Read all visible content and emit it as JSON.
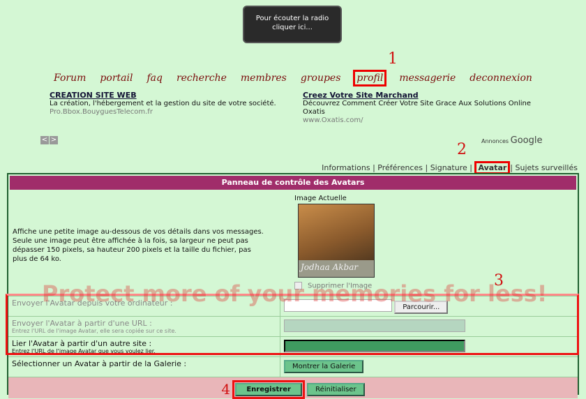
{
  "radio": {
    "text": "Pour écouter la radio cliquer ici..."
  },
  "nav": [
    "Forum",
    "portail",
    "faq",
    "recherche",
    "membres",
    "groupes",
    "profil",
    "messagerie",
    "deconnexion"
  ],
  "annotations": [
    "1",
    "2",
    "3",
    "4"
  ],
  "ads": [
    {
      "title": "CREATION SITE WEB",
      "text": "La création, l'hébergement et la gestion du site de votre société.",
      "url": "Pro.Bbox.BouyguesTelecom.fr"
    },
    {
      "title": "Creez Votre Site Marchand",
      "text": "Découvrez Comment Créer Votre Site Grace Aux Solutions Online Oxatis",
      "url": "www.Oxatis.com/"
    }
  ],
  "annonces": "Annonces",
  "google": "Google",
  "tabs": [
    "Informations",
    "Préférences",
    "Signature",
    "Avatar",
    "Sujets surveillés"
  ],
  "panel": {
    "title": "Panneau de contrôle des Avatars",
    "description": "Affiche une petite image au-dessous de vos détails dans vos messages. Seule une image peut être affichée à la fois, sa largeur ne peut pas dépasser 150 pixels, sa hauteur 200 pixels et la taille du fichier, pas plus de 64 ko.",
    "current_image": "Image Actuelle",
    "avatar_caption": "Jodhaa Akbar",
    "delete_label": "Supprimer l'Image",
    "upload_label": "Envoyer l'Avatar depuis votre ordinateur :",
    "browse": "Parcourir...",
    "url_label": "Envoyer l'Avatar à partir d'une URL :",
    "url_help": "Entrez l'URL de l'image Avatar, elle sera copiée sur ce site.",
    "link_label": "Lier l'Avatar à partir d'un autre site :",
    "link_help": "Entrez l'URL de l'image Avatar que vous voulez lier.",
    "gallery_label": "Sélectionner un Avatar à partir de la Galerie :",
    "gallery_button": "Montrer la Galerie",
    "save": "Enregistrer",
    "reset": "Réinitialiser"
  },
  "watermark": "Protect more of your memories for less!"
}
